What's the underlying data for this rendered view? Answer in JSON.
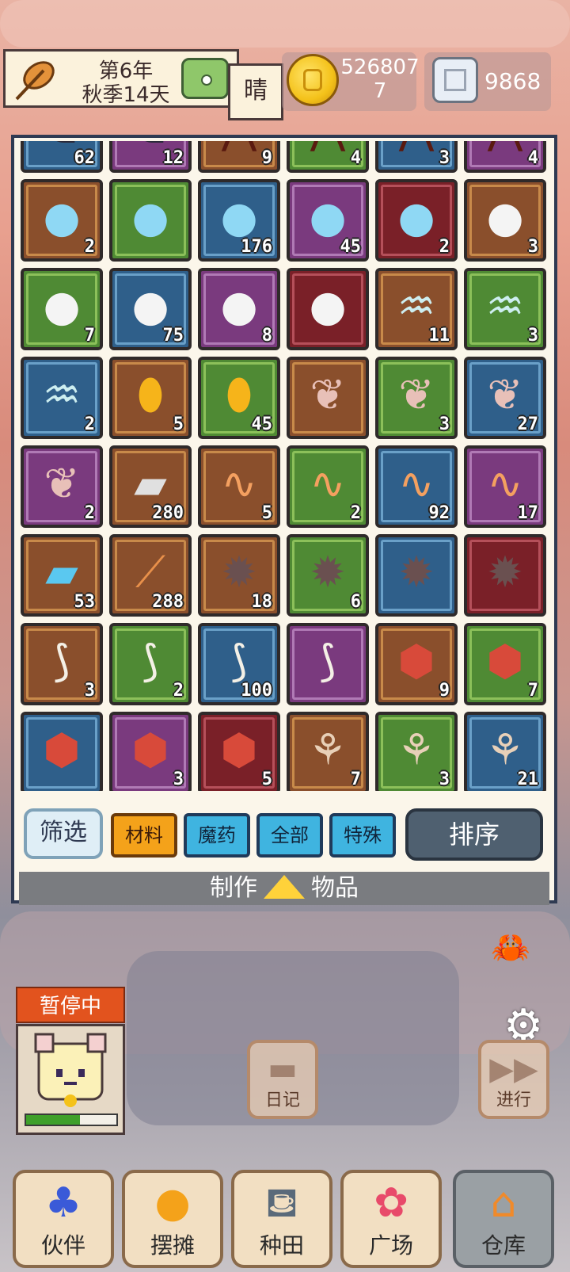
{
  "header": {
    "year": "第6年",
    "season_day": "秋季14天",
    "weather": "晴",
    "gold_top": "526807",
    "gold_bottom": "7",
    "gems": "9868"
  },
  "inventory": {
    "items": [
      {
        "icon": "rune-icon",
        "color": "c-blue",
        "count": "62",
        "glyph": "ᘓ",
        "fg": "#2a2a3a"
      },
      {
        "icon": "rune-icon",
        "color": "c-purple",
        "count": "12",
        "glyph": "ᘓ",
        "fg": "#2a2a3a"
      },
      {
        "icon": "branch-icon",
        "color": "c-brown",
        "count": "9",
        "glyph": "⋀",
        "fg": "#5a1a10"
      },
      {
        "icon": "branch-icon",
        "color": "c-green",
        "count": "4",
        "glyph": "⋀",
        "fg": "#5a1a10"
      },
      {
        "icon": "branch-icon",
        "color": "c-blue",
        "count": "3",
        "glyph": "⋀",
        "fg": "#5a1a10"
      },
      {
        "icon": "branch-icon",
        "color": "c-purple",
        "count": "4",
        "glyph": "⋀",
        "fg": "#5a1a10"
      },
      {
        "icon": "potion-icon",
        "color": "c-brown",
        "count": "2",
        "glyph": "●",
        "fg": "#8fd8f4"
      },
      {
        "icon": "potion-icon",
        "color": "c-green",
        "count": "",
        "glyph": "●",
        "fg": "#8fd8f4"
      },
      {
        "icon": "potion-icon",
        "color": "c-blue",
        "count": "176",
        "glyph": "●",
        "fg": "#8fd8f4"
      },
      {
        "icon": "potion-icon",
        "color": "c-purple",
        "count": "45",
        "glyph": "●",
        "fg": "#8fd8f4"
      },
      {
        "icon": "potion-icon",
        "color": "c-red",
        "count": "2",
        "glyph": "●",
        "fg": "#8fd8f4"
      },
      {
        "icon": "pearl-icon",
        "color": "c-brown",
        "count": "3",
        "glyph": "●",
        "fg": "#f4f4f4"
      },
      {
        "icon": "pearl-icon",
        "color": "c-green",
        "count": "7",
        "glyph": "●",
        "fg": "#f4f4f4"
      },
      {
        "icon": "pearl-icon",
        "color": "c-blue",
        "count": "75",
        "glyph": "●",
        "fg": "#f4f4f4"
      },
      {
        "icon": "pearl-icon",
        "color": "c-purple",
        "count": "8",
        "glyph": "●",
        "fg": "#f4f4f4"
      },
      {
        "icon": "pearl-icon",
        "color": "c-red",
        "count": "",
        "glyph": "●",
        "fg": "#f4f4f4"
      },
      {
        "icon": "jellyfish-icon",
        "color": "c-brown",
        "count": "11",
        "glyph": "♒",
        "fg": "#cdeef0"
      },
      {
        "icon": "jellyfish-icon",
        "color": "c-green",
        "count": "3",
        "glyph": "♒",
        "fg": "#cdeef0"
      },
      {
        "icon": "jellyfish-icon",
        "color": "c-blue",
        "count": "2",
        "glyph": "♒",
        "fg": "#cdeef0"
      },
      {
        "icon": "amber-icon",
        "color": "c-brown",
        "count": "5",
        "glyph": "⬮",
        "fg": "#f6b41a"
      },
      {
        "icon": "amber-icon",
        "color": "c-green",
        "count": "45",
        "glyph": "⬮",
        "fg": "#f6b41a"
      },
      {
        "icon": "feather-icon",
        "color": "c-brown",
        "count": "",
        "glyph": "❦",
        "fg": "#e8c0b8"
      },
      {
        "icon": "feather-icon",
        "color": "c-green",
        "count": "3",
        "glyph": "❦",
        "fg": "#e8c0b8"
      },
      {
        "icon": "feather-icon",
        "color": "c-blue",
        "count": "27",
        "glyph": "❦",
        "fg": "#e8c0b8"
      },
      {
        "icon": "feather-icon",
        "color": "c-purple",
        "count": "2",
        "glyph": "❦",
        "fg": "#e8c0b8"
      },
      {
        "icon": "iron-bar-icon",
        "color": "c-brown",
        "count": "280",
        "glyph": "▰",
        "fg": "#e0e0e0"
      },
      {
        "icon": "worm-icon",
        "color": "c-brown",
        "count": "5",
        "glyph": "∿",
        "fg": "#f4a060"
      },
      {
        "icon": "worm-icon",
        "color": "c-green",
        "count": "2",
        "glyph": "∿",
        "fg": "#f4a060"
      },
      {
        "icon": "worm-icon",
        "color": "c-blue",
        "count": "92",
        "glyph": "∿",
        "fg": "#f4a060"
      },
      {
        "icon": "worm-icon",
        "color": "c-purple",
        "count": "17",
        "glyph": "∿",
        "fg": "#f4a060"
      },
      {
        "icon": "crystal-bar-icon",
        "color": "c-brown",
        "count": "53",
        "glyph": "▰",
        "fg": "#5ac8f0"
      },
      {
        "icon": "wood-icon",
        "color": "c-brown",
        "count": "288",
        "glyph": "⟋",
        "fg": "#e8904a"
      },
      {
        "icon": "urchin-icon",
        "color": "c-brown",
        "count": "18",
        "glyph": "✹",
        "fg": "#6a5050"
      },
      {
        "icon": "urchin-icon",
        "color": "c-green",
        "count": "6",
        "glyph": "✹",
        "fg": "#6a5050"
      },
      {
        "icon": "urchin-icon",
        "color": "c-blue",
        "count": "",
        "glyph": "✹",
        "fg": "#6a5050"
      },
      {
        "icon": "urchin-icon",
        "color": "c-red",
        "count": "",
        "glyph": "✹",
        "fg": "#6a5050"
      },
      {
        "icon": "bone-icon",
        "color": "c-brown",
        "count": "3",
        "glyph": "⟆",
        "fg": "#f4f0e6"
      },
      {
        "icon": "bone-icon",
        "color": "c-green",
        "count": "2",
        "glyph": "⟆",
        "fg": "#f4f0e6"
      },
      {
        "icon": "bone-icon",
        "color": "c-blue",
        "count": "100",
        "glyph": "⟆",
        "fg": "#f4f0e6"
      },
      {
        "icon": "bone-icon",
        "color": "c-purple",
        "count": "",
        "glyph": "⟆",
        "fg": "#f4f0e6"
      },
      {
        "icon": "meat-icon",
        "color": "c-brown",
        "count": "9",
        "glyph": "⬢",
        "fg": "#d84a3a"
      },
      {
        "icon": "meat-icon",
        "color": "c-green",
        "count": "7",
        "glyph": "⬢",
        "fg": "#d84a3a"
      },
      {
        "icon": "meat-icon",
        "color": "c-blue",
        "count": "",
        "glyph": "⬢",
        "fg": "#d84a3a"
      },
      {
        "icon": "meat-icon",
        "color": "c-purple",
        "count": "3",
        "glyph": "⬢",
        "fg": "#d84a3a"
      },
      {
        "icon": "meat-icon",
        "color": "c-red",
        "count": "5",
        "glyph": "⬢",
        "fg": "#d84a3a"
      },
      {
        "icon": "root-icon",
        "color": "c-brown",
        "count": "7",
        "glyph": "⚘",
        "fg": "#e8d0b8"
      },
      {
        "icon": "root-icon",
        "color": "c-green",
        "count": "3",
        "glyph": "⚘",
        "fg": "#e8d0b8"
      },
      {
        "icon": "root-icon",
        "color": "c-blue",
        "count": "21",
        "glyph": "⚘",
        "fg": "#e8d0b8"
      }
    ]
  },
  "filters": {
    "filter_label": "筛选",
    "tabs": [
      "材料",
      "魔药",
      "全部",
      "特殊"
    ],
    "active_tab": "材料",
    "sort_label": "排序"
  },
  "craft": {
    "left": "制作",
    "right": "物品"
  },
  "status": {
    "paused": "暂停中",
    "energy_fraction": 0.6
  },
  "side_buttons": {
    "diary": "日记",
    "proceed": "进行"
  },
  "nav": [
    "伙伴",
    "摆摊",
    "种田",
    "广场",
    "仓库"
  ],
  "nav_active": "仓库",
  "colors": {
    "accent": "#f4a21a",
    "tab": "#3fb4e0",
    "paused": "#e2531e"
  }
}
